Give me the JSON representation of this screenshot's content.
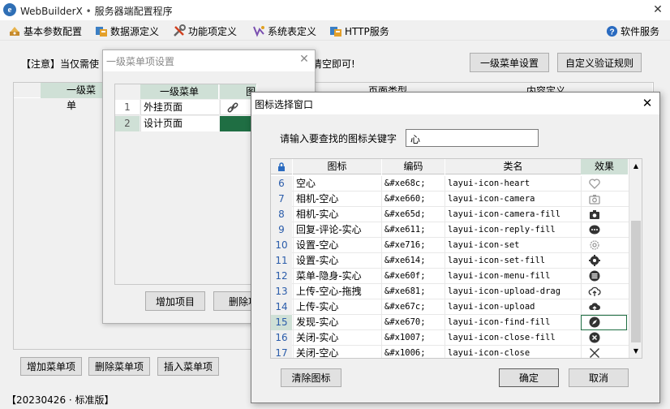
{
  "app": {
    "title": "WebBuilderX",
    "title_sep": "•",
    "subtitle": "服务器端配置程序",
    "close": "✕"
  },
  "menu": [
    {
      "label": "基本参数配置",
      "icon": "settings-icon"
    },
    {
      "label": "数据源定义",
      "icon": "database-icon"
    },
    {
      "label": "功能项定义",
      "icon": "tools-icon"
    },
    {
      "label": "系统表定义",
      "icon": "table-icon"
    },
    {
      "label": "HTTP服务",
      "icon": "http-icon"
    }
  ],
  "menu_right": {
    "label": "软件服务",
    "icon": "help-icon"
  },
  "main": {
    "notice_left": "【注意】当仅需使",
    "notice_right": "清空即可!",
    "btn_level1": "一级菜单设置",
    "btn_verify": "自定义验证规则",
    "grid_headers": [
      "一级菜单",
      "页面类型",
      "内容定义"
    ],
    "btn_add": "增加菜单项",
    "btn_delete": "删除菜单项",
    "btn_insert": "插入菜单项"
  },
  "status": {
    "text": "【20230426 · 标准版】"
  },
  "dialog1": {
    "title": "一级菜单项设置",
    "close": "✕",
    "headers": [
      "一级菜单",
      "图标"
    ],
    "rows": [
      {
        "num": "1",
        "name": "外挂页面",
        "icon": "link-icon"
      },
      {
        "num": "2",
        "name": "设计页面",
        "icon": ""
      }
    ],
    "btn_add": "增加项目",
    "btn_delete": "删除项"
  },
  "dialog2": {
    "title": "图标选择窗口",
    "close": "✕",
    "search_label": "请输入要查找的图标关键字",
    "search_value": "心",
    "headers": [
      "图标",
      "编码",
      "类名",
      "效果"
    ],
    "rows": [
      {
        "num": "6",
        "name": "空心",
        "code": "&#xe68c;",
        "cls": "layui-icon-heart",
        "effect": "heart"
      },
      {
        "num": "7",
        "name": "相机-空心",
        "code": "&#xe660;",
        "cls": "layui-icon-camera",
        "effect": "camera"
      },
      {
        "num": "8",
        "name": "相机-实心",
        "code": "&#xe65d;",
        "cls": "layui-icon-camera-fill",
        "effect": "camera-fill"
      },
      {
        "num": "9",
        "name": "回复-评论-实心",
        "code": "&#xe611;",
        "cls": "layui-icon-reply-fill",
        "effect": "reply-fill"
      },
      {
        "num": "10",
        "name": "设置-空心",
        "code": "&#xe716;",
        "cls": "layui-icon-set",
        "effect": "set"
      },
      {
        "num": "11",
        "name": "设置-实心",
        "code": "&#xe614;",
        "cls": "layui-icon-set-fill",
        "effect": "set-fill"
      },
      {
        "num": "12",
        "name": "菜单-隐身-实心",
        "code": "&#xe60f;",
        "cls": "layui-icon-menu-fill",
        "effect": "menu-fill"
      },
      {
        "num": "13",
        "name": "上传-空心-拖拽",
        "code": "&#xe681;",
        "cls": "layui-icon-upload-drag",
        "effect": "upload-drag"
      },
      {
        "num": "14",
        "name": "上传-实心",
        "code": "&#xe67c;",
        "cls": "layui-icon-upload",
        "effect": "upload"
      },
      {
        "num": "15",
        "name": "发现-实心",
        "code": "&#xe670;",
        "cls": "layui-icon-find-fill",
        "effect": "find-fill"
      },
      {
        "num": "16",
        "name": "关闭-实心",
        "code": "&#x1007;",
        "cls": "layui-icon-close-fill",
        "effect": "close-fill"
      },
      {
        "num": "17",
        "name": "关闭-空心",
        "code": "&#x1006;",
        "cls": "layui-icon-close",
        "effect": "close"
      }
    ],
    "btn_clear": "清除图标",
    "btn_ok": "确定",
    "btn_cancel": "取消"
  }
}
